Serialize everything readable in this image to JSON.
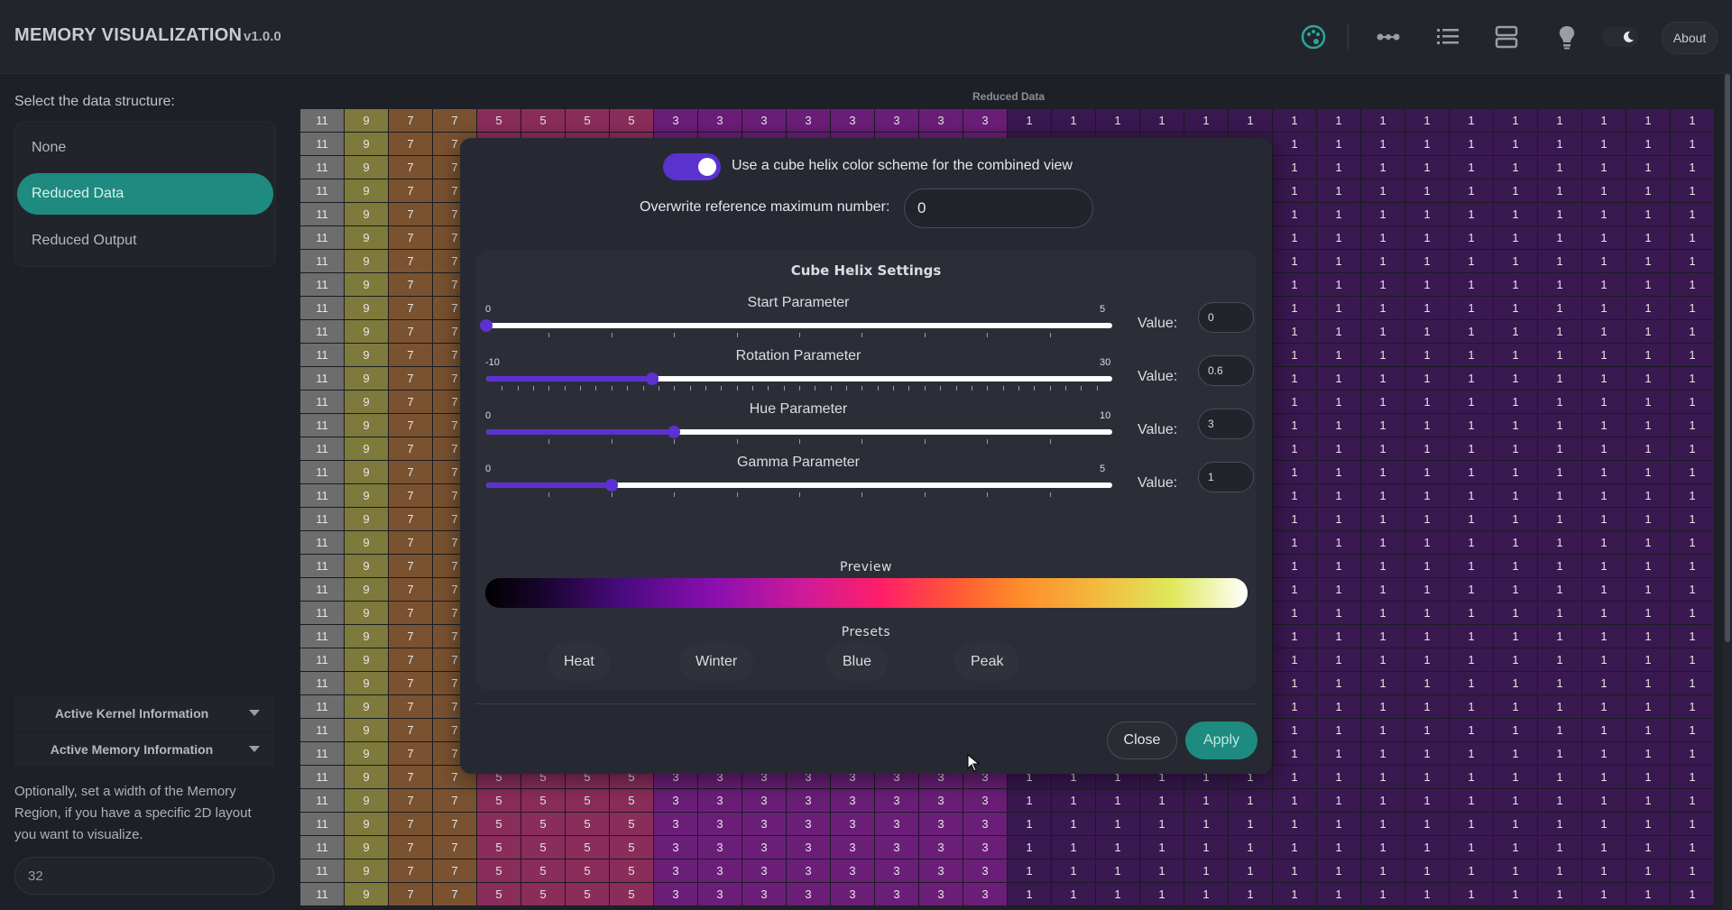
{
  "header": {
    "title": "MEMORY VISUALIZATION",
    "version": "v1.0.0",
    "about_label": "About",
    "icons": [
      "palette-icon",
      "connection-icon",
      "list-icon",
      "layout-icon",
      "lightbulb-icon",
      "moon-icon"
    ]
  },
  "sidebar": {
    "select_label": "Select the data structure:",
    "items": [
      {
        "label": "None",
        "active": false
      },
      {
        "label": "Reduced Data",
        "active": true
      },
      {
        "label": "Reduced Output",
        "active": false
      }
    ],
    "accordions": [
      {
        "label": "Active Kernel Information"
      },
      {
        "label": "Active Memory Information"
      }
    ],
    "width_note": "Optionally, set a width of the Memory Region, if you have a specific 2D layout you want to visualize.",
    "width_value": "32"
  },
  "grid": {
    "title": "Reduced Data",
    "columns": 32,
    "rows": 34,
    "segments": [
      {
        "value": "11",
        "count": 1,
        "color": "#6d6d6d"
      },
      {
        "value": "9",
        "count": 1,
        "color": "#7d7a3c"
      },
      {
        "value": "7",
        "count": 2,
        "color": "#7a5230"
      },
      {
        "value": "5",
        "count": 4,
        "color": "#8b2d5a"
      },
      {
        "value": "3",
        "count": 8,
        "color": "#6b1e78"
      },
      {
        "value": "1",
        "count": 16,
        "color": "#3a1850"
      }
    ]
  },
  "modal": {
    "toggle_label": "Use a cube helix color scheme for the combined view",
    "toggle_on": true,
    "overwrite_label": "Overwrite reference maximum number:",
    "overwrite_value": "0",
    "panel_title": "Cube Helix Settings",
    "value_label": "Value:",
    "params": [
      {
        "name": "Start Parameter",
        "min": "0",
        "max": "5",
        "value": "0",
        "fraction": 0.0,
        "ticks": 10
      },
      {
        "name": "Rotation Parameter",
        "min": "-10",
        "max": "30",
        "value": "0.6",
        "fraction": 0.265,
        "ticks": 40
      },
      {
        "name": "Hue Parameter",
        "min": "0",
        "max": "10",
        "value": "3",
        "fraction": 0.3,
        "ticks": 10
      },
      {
        "name": "Gamma Parameter",
        "min": "0",
        "max": "5",
        "value": "1",
        "fraction": 0.2,
        "ticks": 10
      }
    ],
    "preview_label": "Preview",
    "presets_label": "Presets",
    "presets": [
      "Heat",
      "Winter",
      "Blue",
      "Peak"
    ],
    "close_label": "Close",
    "apply_label": "Apply"
  },
  "colors": {
    "accent": "#5b32cf",
    "teal": "#1f8a80"
  }
}
